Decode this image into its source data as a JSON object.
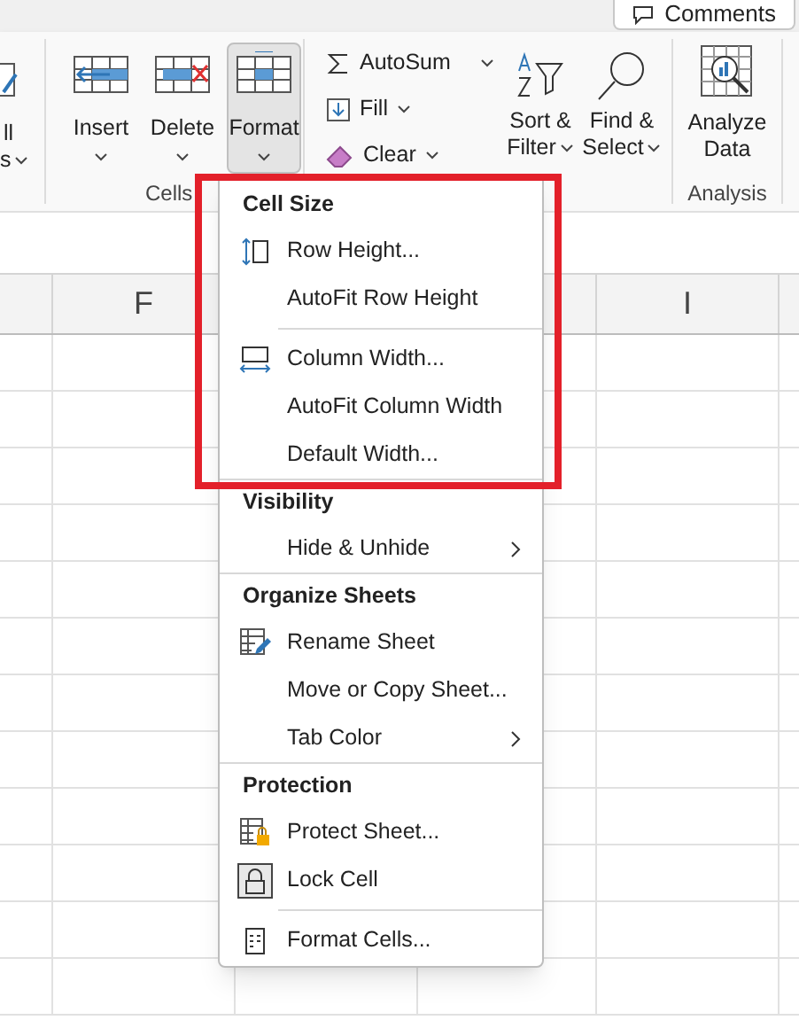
{
  "top_bar": {
    "comments_button": "Comments"
  },
  "ribbon": {
    "partial_group": {
      "lines": [
        "ll",
        "s"
      ]
    },
    "cells_group": {
      "label": "Cells",
      "buttons": [
        {
          "label": "Insert",
          "selected": false
        },
        {
          "label": "Delete",
          "selected": false
        },
        {
          "label": "Format",
          "selected": true
        }
      ]
    },
    "editing_group": {
      "small_buttons": [
        {
          "label": "AutoSum"
        },
        {
          "label": "Fill"
        },
        {
          "label": "Clear"
        }
      ],
      "large_buttons": [
        {
          "lines": [
            "Sort &",
            "Filter"
          ]
        },
        {
          "lines": [
            "Find &",
            "Select"
          ]
        }
      ]
    },
    "analysis_group": {
      "label": "Analysis",
      "button": {
        "lines": [
          "Analyze",
          "Data"
        ]
      }
    }
  },
  "sheet": {
    "columns": [
      {},
      {
        "header": "F"
      },
      {},
      {},
      {
        "header": "I"
      },
      {}
    ]
  },
  "menu": {
    "items": [
      {
        "kind": "header",
        "label": "Cell Size"
      },
      {
        "kind": "item",
        "label": "Row Height..."
      },
      {
        "kind": "item",
        "label": "AutoFit Row Height"
      },
      {
        "kind": "separator"
      },
      {
        "kind": "item",
        "label": "Column Width..."
      },
      {
        "kind": "item",
        "label": "AutoFit Column Width"
      },
      {
        "kind": "item",
        "label": "Default Width..."
      },
      {
        "kind": "header",
        "label": "Visibility"
      },
      {
        "kind": "item",
        "label": "Hide & Unhide",
        "submenu": true
      },
      {
        "kind": "header",
        "label": "Organize Sheets"
      },
      {
        "kind": "item",
        "label": "Rename Sheet"
      },
      {
        "kind": "item",
        "label": "Move or Copy Sheet..."
      },
      {
        "kind": "item",
        "label": "Tab Color",
        "submenu": true
      },
      {
        "kind": "header",
        "label": "Protection"
      },
      {
        "kind": "item",
        "label": "Protect Sheet..."
      },
      {
        "kind": "item",
        "label": "Lock Cell",
        "checked": true
      },
      {
        "kind": "separator"
      },
      {
        "kind": "item",
        "label": "Format Cells..."
      }
    ]
  }
}
